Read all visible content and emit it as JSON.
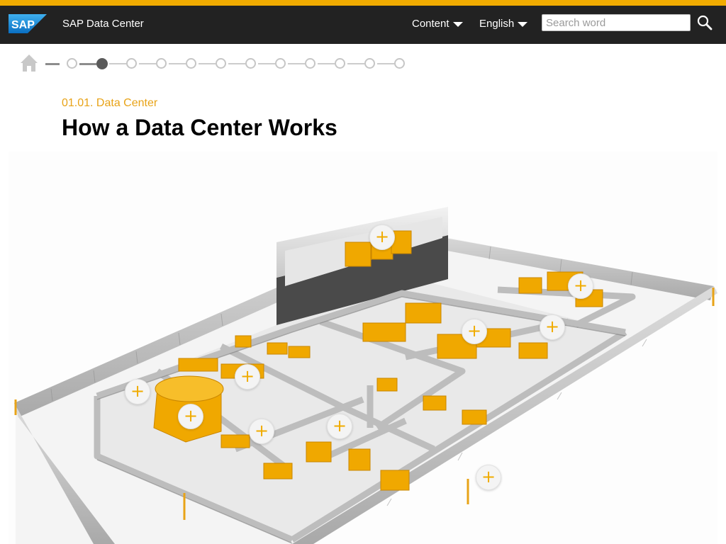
{
  "header": {
    "logo_text": "SAP",
    "title": "SAP Data Center",
    "content_menu": "Content",
    "language_menu": "English",
    "search_placeholder": "Search word",
    "search_value": ""
  },
  "progress": {
    "total_steps": 12,
    "current_step": 2
  },
  "main": {
    "subtitle": "01.01. Data Center",
    "title": "How a Data Center Works"
  },
  "hotspots": {
    "count": 10,
    "symbol": "+"
  },
  "icons": [
    "search-icon",
    "home-icon",
    "chevron-down-icon",
    "plus-icon"
  ],
  "colors": {
    "accent": "#f0ab00",
    "header_bg": "#222222",
    "subtitle": "#e8a317",
    "logo_blue": "#1a8fd6"
  }
}
